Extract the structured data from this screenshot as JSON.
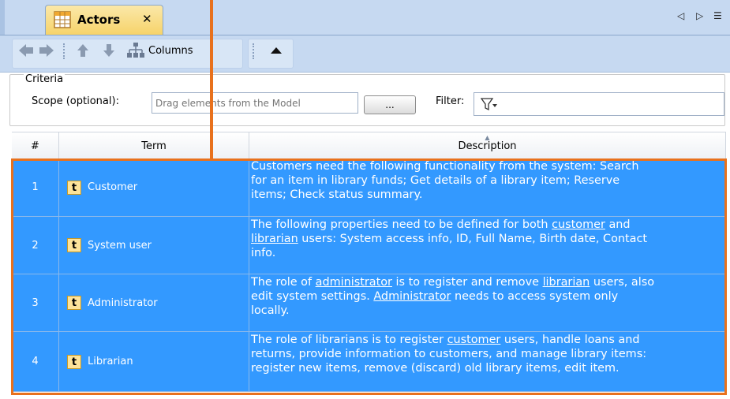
{
  "tab": {
    "title": "Actors",
    "close": "✕"
  },
  "tab_nav": {
    "prev": "◁",
    "next": "▷",
    "menu": "☰"
  },
  "toolbar": {
    "columns_label": "Columns"
  },
  "criteria": {
    "legend": "Criteria",
    "scope_label": "Scope (optional):",
    "scope_placeholder": "Drag elements from the Model",
    "dots_label": "...",
    "filter_label": "Filter:"
  },
  "table": {
    "headers": {
      "num": "#",
      "term": "Term",
      "description": "Description"
    },
    "rows": [
      {
        "num": "1",
        "term": "Customer",
        "description": "Customers need the following functionality from the system: Search\nfor an item in library funds; Get details of a library item; Reserve\nitems; Check status summary."
      },
      {
        "num": "2",
        "term": "System user",
        "desc_parts": [
          "The following properties need to be defined for both ",
          "customer",
          " and\n",
          "librarian",
          " users: System access info, ID, Full Name, Birth date, Contact\ninfo."
        ]
      },
      {
        "num": "3",
        "term": "Administrator",
        "desc_parts": [
          "The role of ",
          "administrator",
          " is to register and remove ",
          "librarian",
          " users, also\nedit system settings. ",
          "Administrator",
          " needs to access system only\nlocally."
        ]
      },
      {
        "num": "4",
        "term": "Librarian",
        "desc_parts": [
          "The role of librarians is to register ",
          "customer",
          " users, handle loans and\nreturns, provide information to customers, and manage library items:\nregister new items, remove (discard) old library items, edit item."
        ]
      }
    ]
  },
  "colors": {
    "selection": "#3399ff",
    "callout": "#e8711d",
    "tab": "#f6d36a",
    "toolbar": "#c6d9f1"
  }
}
